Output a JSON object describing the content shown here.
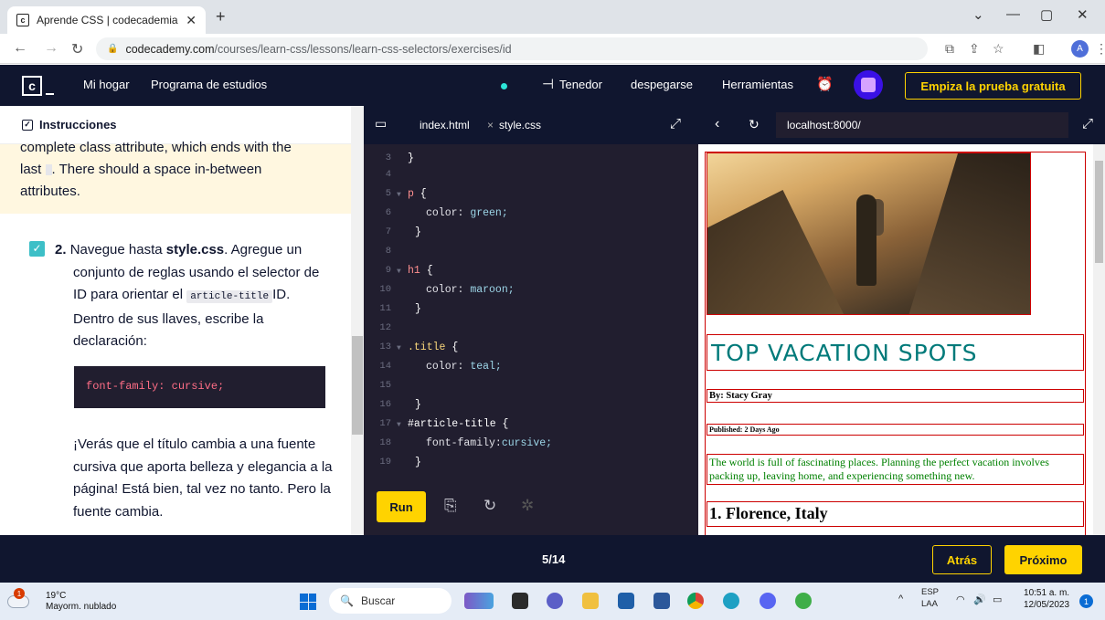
{
  "browser": {
    "tab_title": "Aprende CSS | codecademia",
    "url_host": "codecademy.com",
    "url_path": "/courses/learn-css/lessons/learn-css-selectors/exercises/id"
  },
  "header": {
    "nav_home": "Mi hogar",
    "nav_program": "Programa de estudios",
    "fork": "Tenedor",
    "unstick": "despegarse",
    "tools": "Herramientas",
    "trial_button": "Empiza la prueba gratuita"
  },
  "instructions": {
    "title": "Instrucciones",
    "hint_line1": "complete class attribute, which ends with the",
    "hint_line2_a": "last",
    "hint_line2_b": ". There should a space in-between",
    "hint_line3": "attributes.",
    "step_number": "2.",
    "step_a": "Navegue hasta",
    "step_file": "style.css",
    "step_b": ". Agregue un conjunto de reglas usando el selector de ID para orientar el",
    "step_code": "article-title",
    "step_c": "ID. Dentro de sus llaves, escribe la declaración:",
    "codeblock": "font-family: cursive;",
    "paragraph": "¡Verás que el título cambia a una fuente cursiva que aporta belleza y elegancia a la página! Está bien, tal vez no tanto. Pero la fuente cambia."
  },
  "editor": {
    "tab1": "index.html",
    "tab2": "style.css",
    "lines": {
      "n3": "3",
      "n4": "4",
      "n5": "5",
      "n6": "6",
      "n7": "7",
      "n8": "8",
      "n9": "9",
      "n10": "10",
      "n11": "11",
      "n12": "12",
      "n13": "13",
      "n14": "14",
      "n15": "15",
      "n16": "16",
      "n17": "17",
      "n18": "18",
      "n19": "19"
    },
    "code": {
      "l3": "}",
      "l5_sel": "p",
      "l5_brace": " {",
      "l6_prop": "color:",
      "l6_val": " green;",
      "l7": "}",
      "l9_sel": "h1",
      "l9_brace": " {",
      "l10_prop": "color:",
      "l10_val": " maroon;",
      "l11": "}",
      "l13_sel": ".title",
      "l13_brace": " {",
      "l14_prop": "color:",
      "l14_val": " teal;",
      "l16": "}",
      "l17_sel": "#article-title",
      "l17_brace": " {",
      "l18_prop": "font-family:",
      "l18_val": "cursive;",
      "l19": "}"
    },
    "run_button": "Run"
  },
  "preview": {
    "url": "localhost:8000/",
    "title": "TOP VACATION SPOTS",
    "byline": "By: Stacy Gray",
    "published": "Published: 2 Days Ago",
    "description": "The world is full of fascinating places. Planning the perfect vacation involves packing up, leaving home, and experiencing something new.",
    "heading2": "1. Florence, Italy"
  },
  "footer": {
    "progress": "5/14",
    "back_button": "Atrás",
    "next_button": "Próximo"
  },
  "taskbar": {
    "weather_temp": "19°C",
    "weather_desc": "Mayorm. nublado",
    "weather_badge": "1",
    "search_placeholder": "Buscar",
    "lang_top": "ESP",
    "lang_bottom": "LAA",
    "time": "10:51 a. m.",
    "date": "12/05/2023",
    "notifications": "1"
  },
  "colors": {
    "codecademy_navy": "#10162f",
    "accent_yellow": "#ffd300",
    "editor_bg": "#211e2f",
    "preview_title": "#007a7a",
    "preview_desc": "#008000",
    "preview_border": "#cc0000"
  }
}
